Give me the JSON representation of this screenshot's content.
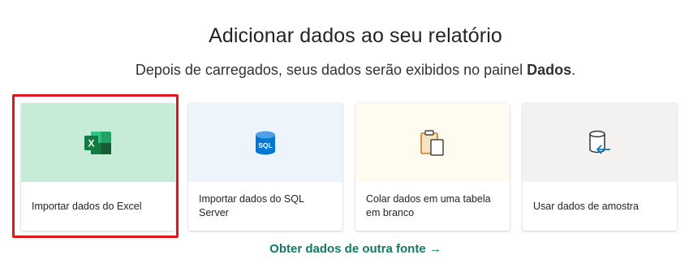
{
  "header": {
    "title": "Adicionar dados ao seu relatório",
    "subtitle_prefix": "Depois de carregados, seus dados serão exibidos no painel ",
    "subtitle_bold": "Dados",
    "subtitle_suffix": "."
  },
  "cards": [
    {
      "label": "Importar dados do Excel",
      "icon": "excel-icon",
      "highlighted": true
    },
    {
      "label": "Importar dados do SQL Server",
      "icon": "sql-database-icon",
      "icon_text": "SQL"
    },
    {
      "label": "Colar dados em uma tabela em branco",
      "icon": "clipboard-paste-icon"
    },
    {
      "label": "Usar dados de amostra",
      "icon": "sample-data-icon"
    }
  ],
  "footer": {
    "link_label": "Obter dados de outra fonte →"
  },
  "colors": {
    "excel_green": "#107c41",
    "sql_blue": "#0078d4",
    "link_teal": "#117865",
    "highlight_red": "#e3141b"
  }
}
